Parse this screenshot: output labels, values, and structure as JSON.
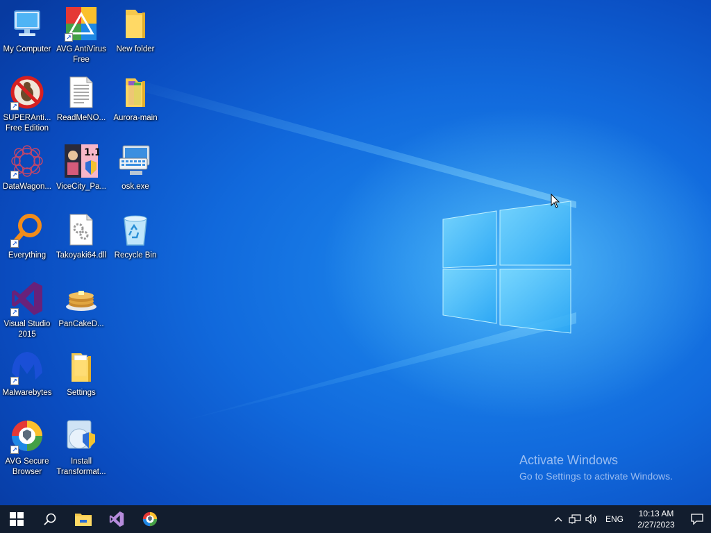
{
  "desktop": {
    "icons": [
      {
        "label": "My Computer",
        "icon": "computer-icon",
        "shortcut": false
      },
      {
        "label": "AVG AntiVirus Free",
        "icon": "avg-antivirus-icon",
        "shortcut": true
      },
      {
        "label": "New folder",
        "icon": "folder-icon",
        "shortcut": false
      },
      {
        "label": "SUPERAnti... Free Edition",
        "icon": "superantispyware-icon",
        "shortcut": true
      },
      {
        "label": "ReadMeNO...",
        "icon": "text-file-icon",
        "shortcut": false
      },
      {
        "label": "Aurora-main",
        "icon": "folder-icon",
        "shortcut": false
      },
      {
        "label": "DataWagon...",
        "icon": "datawagon-icon",
        "shortcut": true
      },
      {
        "label": "ViceCity_Pa...",
        "icon": "vicecity-icon",
        "shortcut": false
      },
      {
        "label": "osk.exe",
        "icon": "keyboard-icon",
        "shortcut": false
      },
      {
        "label": "Everything",
        "icon": "everything-search-icon",
        "shortcut": true
      },
      {
        "label": "Takoyaki64.dll",
        "icon": "dll-file-icon",
        "shortcut": false
      },
      {
        "label": "Recycle Bin",
        "icon": "recycle-bin-icon",
        "shortcut": false
      },
      {
        "label": "Visual Studio 2015",
        "icon": "visual-studio-icon",
        "shortcut": true
      },
      {
        "label": "PanCakeD...",
        "icon": "pancake-icon",
        "shortcut": false
      },
      {
        "label": "Malwarebytes",
        "icon": "malwarebytes-icon",
        "shortcut": true
      },
      {
        "label": "Settings",
        "icon": "folder-icon",
        "shortcut": false
      },
      {
        "label": "AVG Secure Browser",
        "icon": "avg-browser-icon",
        "shortcut": true
      },
      {
        "label": "Install Transformat...",
        "icon": "installer-icon",
        "shortcut": false
      }
    ],
    "watermark": {
      "title": "Activate Windows",
      "subtitle": "Go to Settings to activate Windows."
    }
  },
  "taskbar": {
    "pinned": [
      "start-icon",
      "search-icon",
      "file-explorer-icon",
      "visual-studio-icon",
      "avg-browser-icon"
    ],
    "tray": {
      "language": "ENG",
      "time": "10:13 AM",
      "date": "2/27/2023"
    }
  },
  "colors": {
    "taskbar": "#121d2e",
    "wallpaper": "#1169dc",
    "accent": "#0078d7"
  }
}
